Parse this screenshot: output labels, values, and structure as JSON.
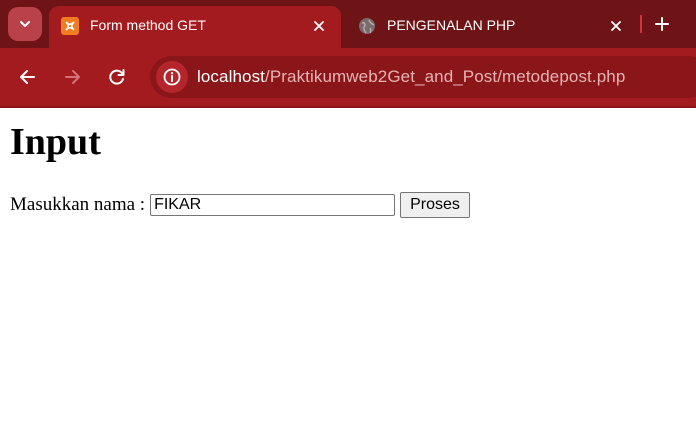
{
  "browser": {
    "tabs": [
      {
        "title": "Form method GET",
        "icon": "xampp-icon",
        "active": true
      },
      {
        "title": "PENGENALAN PHP",
        "icon": "globe-icon",
        "active": false
      }
    ],
    "url_host": "localhost",
    "url_path": "/Praktikumweb2Get_and_Post/metodepost.php",
    "colors": {
      "tabstrip": "#6e1416",
      "toolbar": "#a31b1f",
      "omnibox": "#8a1619"
    }
  },
  "page": {
    "heading": "Input",
    "form": {
      "label": "Masukkan nama :",
      "name_value": "FIKAR",
      "submit_label": "Proses"
    }
  }
}
